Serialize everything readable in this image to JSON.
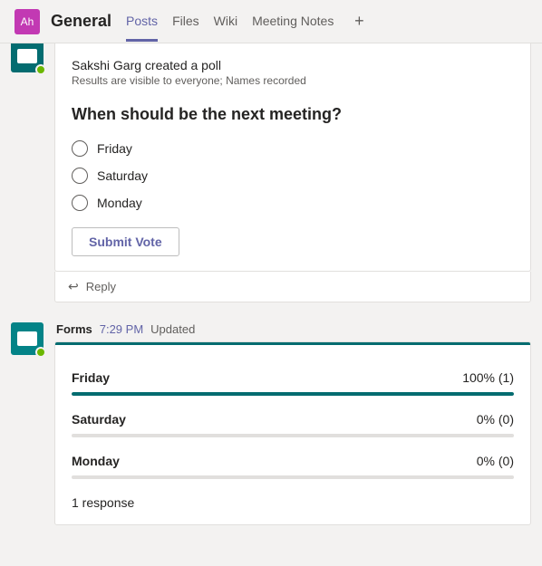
{
  "header": {
    "team_initials": "Ah",
    "channel": "General",
    "tabs": [
      "Posts",
      "Files",
      "Wiki",
      "Meeting Notes"
    ],
    "active_tab_index": 0
  },
  "poll_post": {
    "creator_line": "Sakshi Garg created a poll",
    "visibility_line": "Results are visible to everyone; Names recorded",
    "question": "When should be the next meeting?",
    "options": [
      "Friday",
      "Saturday",
      "Monday"
    ],
    "submit_label": "Submit Vote",
    "reply_label": "Reply"
  },
  "results_post": {
    "sender": "Forms",
    "timestamp": "7:29 PM",
    "status": "Updated",
    "results": [
      {
        "label": "Friday",
        "pct_text": "100% (1)",
        "pct": 100
      },
      {
        "label": "Saturday",
        "pct_text": "0% (0)",
        "pct": 0
      },
      {
        "label": "Monday",
        "pct_text": "0% (0)",
        "pct": 0
      }
    ],
    "responses_text": "1 response"
  }
}
